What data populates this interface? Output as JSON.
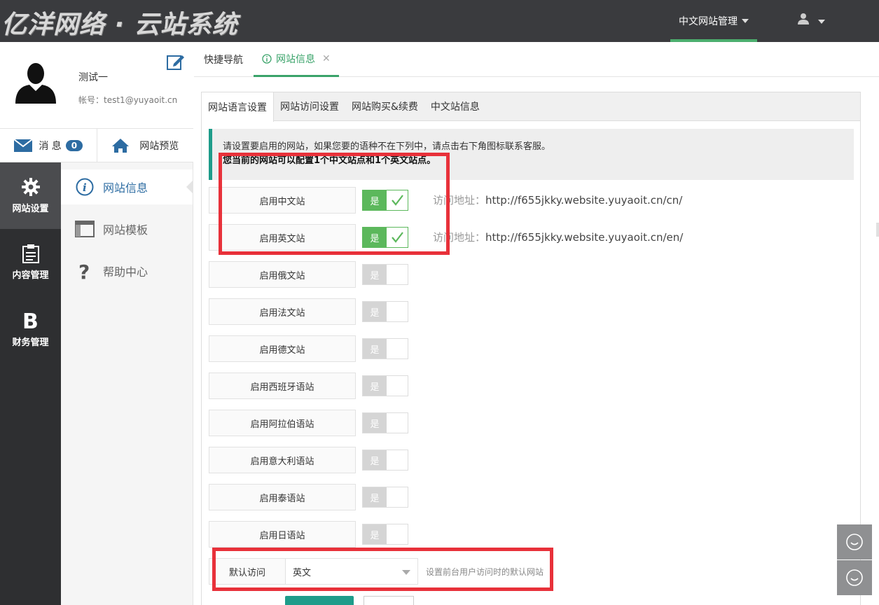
{
  "brand": "亿洋网络 · 云站系统",
  "top_menu": "中文网站管理",
  "profile": {
    "name": "测试一",
    "account_label": "帐号：",
    "account": "test1@yuyaoit.cn"
  },
  "message": {
    "label": "消 息",
    "count": "0"
  },
  "preview": {
    "label": "网站预览"
  },
  "leftnav": [
    {
      "label": "网站设置",
      "icon": "gear-icon",
      "active": true
    },
    {
      "label": "内容管理",
      "icon": "clipboard-icon"
    },
    {
      "label": "财务管理",
      "icon": "b-icon"
    }
  ],
  "submenu": [
    {
      "label": "网站信息",
      "icon": "info-icon",
      "active": true
    },
    {
      "label": "网站模板",
      "icon": "template-icon"
    },
    {
      "label": "帮助中心",
      "icon": "question-icon"
    }
  ],
  "top_tabs": [
    {
      "label": "快捷导航"
    },
    {
      "label": "网站信息",
      "active": true
    }
  ],
  "sub_tabs": [
    "网站语言设置",
    "网站访问设置",
    "网站购买&续费",
    "中文站信息"
  ],
  "notice": {
    "line1": "请设置要启用的网站，如果您要的语种不在下列中，请点击右下角图标联系客服。",
    "line2": "您当前的网站可以配置1个中文站点和1个英文站点。"
  },
  "switch_yes": "是",
  "url_label": "访问地址：",
  "languages": [
    {
      "label": "启用中文站",
      "enabled": true,
      "url": "http://f655jkky.website.yuyaoit.cn/cn/"
    },
    {
      "label": "启用英文站",
      "enabled": true,
      "url": "http://f655jkky.website.yuyaoit.cn/en/"
    },
    {
      "label": "启用俄文站",
      "enabled": false
    },
    {
      "label": "启用法文站",
      "enabled": false
    },
    {
      "label": "启用德文站",
      "enabled": false
    },
    {
      "label": "启用西班牙语站",
      "enabled": false
    },
    {
      "label": "启用阿拉伯语站",
      "enabled": false
    },
    {
      "label": "启用意大利语站",
      "enabled": false
    },
    {
      "label": "启用泰语站",
      "enabled": false
    },
    {
      "label": "启用日语站",
      "enabled": false
    }
  ],
  "default_visit": {
    "label": "默认访问",
    "value": "英文",
    "hint": "设置前台用户访问时的默认网站"
  },
  "colors": {
    "accent": "#3aa36a",
    "teal": "#1e9c8a",
    "highlight": "#e8313a",
    "blue": "#2d6ca2"
  }
}
